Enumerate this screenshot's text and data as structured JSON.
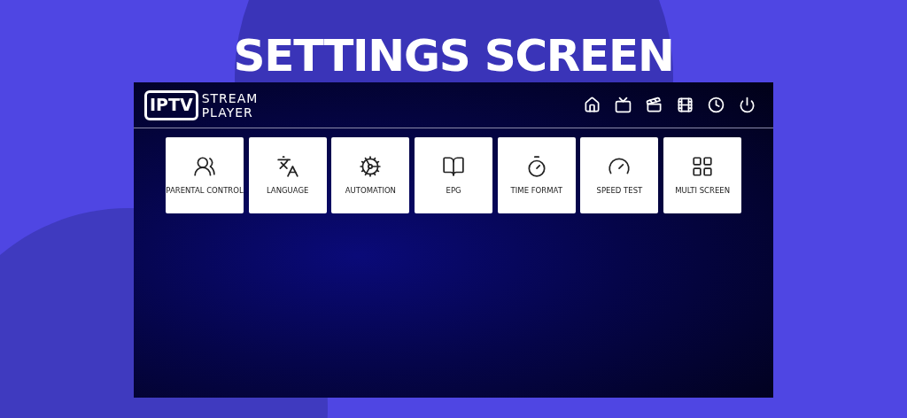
{
  "heading": "SETTINGS SCREEN",
  "app": {
    "logo": {
      "badge": "IPTV",
      "line_1": "STREAM",
      "line_2": "PLAYER"
    },
    "tiles": [
      {
        "label": "PARENTAL CONTROL"
      },
      {
        "label": "LANGUAGE"
      },
      {
        "label": "AUTOMATION"
      },
      {
        "label": "EPG"
      },
      {
        "label": "TIME FORMAT"
      },
      {
        "label": "SPEED TEST"
      },
      {
        "label": "MULTI SCREEN"
      }
    ]
  }
}
